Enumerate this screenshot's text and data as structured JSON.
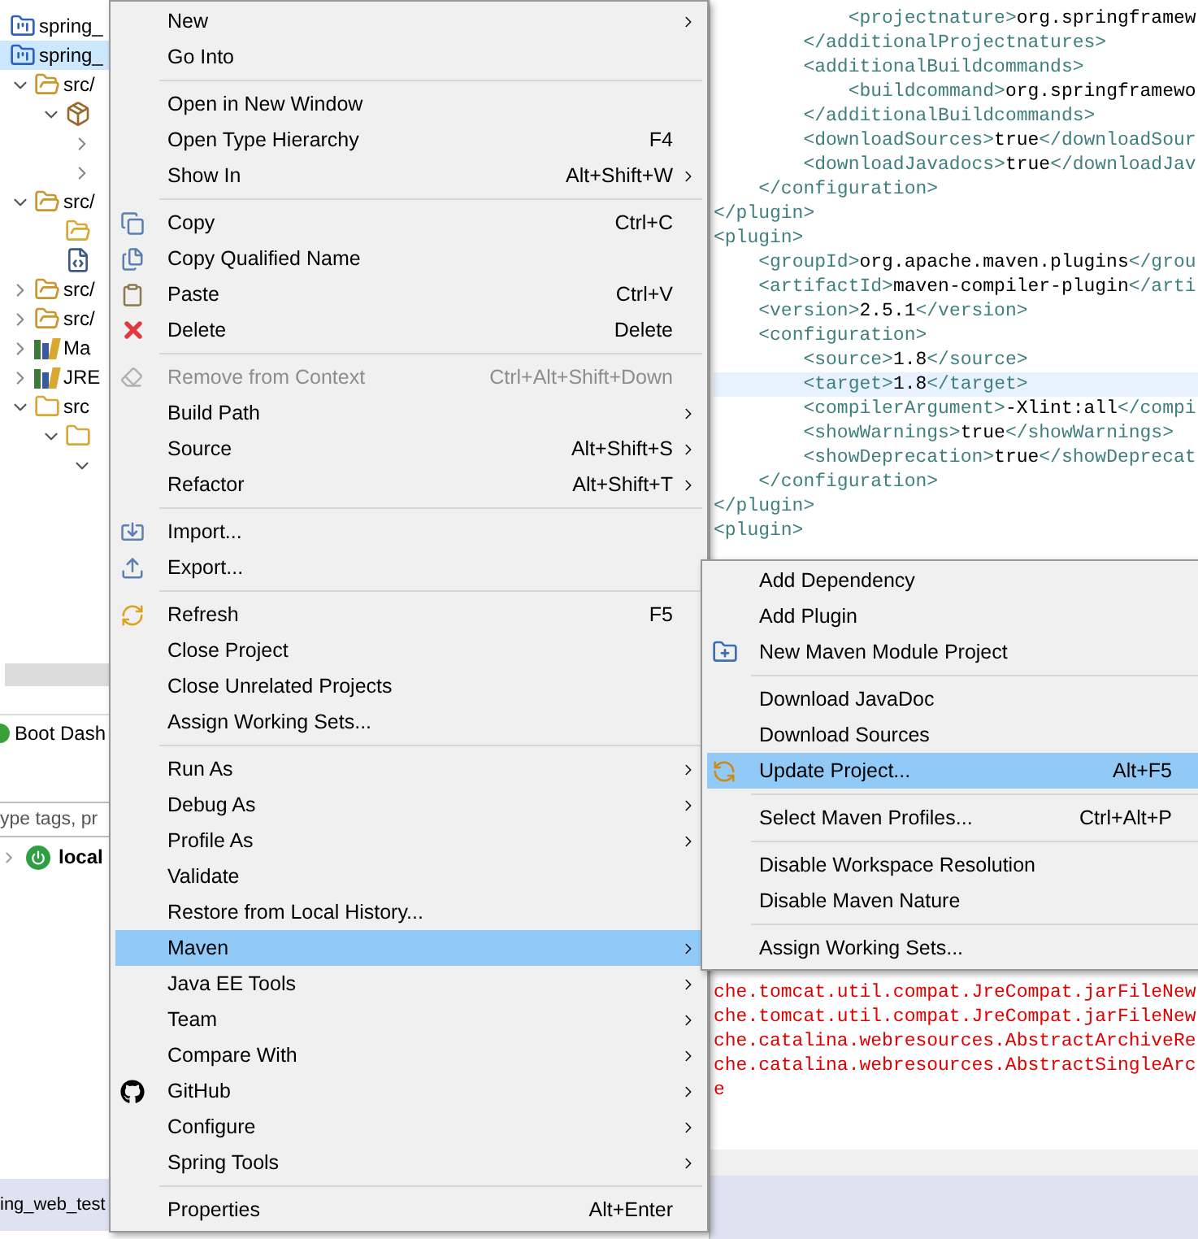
{
  "project_explorer": {
    "items": [
      {
        "label": "spring_",
        "kind": "project",
        "selected": false
      },
      {
        "label": "spring_",
        "kind": "project",
        "selected": true,
        "children": [
          {
            "label": "src/",
            "kind": "source-folder",
            "expanded": true,
            "selected": false,
            "children": [
              {
                "kind": "package",
                "expanded": true,
                "selected": false,
                "children": [
                  {
                    "expanded": false,
                    "selected": false
                  },
                  {
                    "expanded": false,
                    "selected": false
                  }
                ]
              }
            ]
          },
          {
            "label": "src/",
            "kind": "source-folder",
            "expanded": true,
            "selected": false,
            "children": [
              {
                "kind": "folder",
                "selected": false
              },
              {
                "kind": "file",
                "selected": false
              }
            ]
          },
          {
            "label": "src/",
            "kind": "source-folder",
            "expanded": false,
            "selected": false
          },
          {
            "label": "src/",
            "kind": "source-folder",
            "expanded": false,
            "selected": false
          },
          {
            "label": "Ma",
            "kind": "library",
            "expanded": false,
            "selected": false
          },
          {
            "label": "JRE",
            "kind": "library",
            "expanded": false,
            "selected": false
          },
          {
            "label": "src",
            "kind": "spring-folder",
            "expanded": true,
            "selected": false,
            "children": [
              {
                "kind": "spring-folder",
                "expanded": true,
                "selected": false,
                "children": [
                  {
                    "expanded": true,
                    "selected": false
                  }
                ]
              }
            ]
          }
        ]
      }
    ]
  },
  "boot_dashboard": {
    "tab": "Boot Dash",
    "search": {
      "placeholder": "ype tags, pr"
    },
    "targets": [
      {
        "label": "local",
        "expanded": false
      }
    ]
  },
  "editor": {
    "lines": [
      {
        "text": "            <projectnature>org.springframew",
        "current": false
      },
      {
        "text": "        </additionalProjectnatures>",
        "current": false
      },
      {
        "text": "        <additionalBuildcommands>",
        "current": false
      },
      {
        "text": "            <buildcommand>org.springframewo",
        "current": false
      },
      {
        "text": "        </additionalBuildcommands>",
        "current": false
      },
      {
        "text": "        <downloadSources>true</downloadSour",
        "current": false
      },
      {
        "text": "        <downloadJavadocs>true</downloadJav",
        "current": false
      },
      {
        "text": "    </configuration>",
        "current": false
      },
      {
        "text": "</plugin>",
        "current": false
      },
      {
        "text": "<plugin>",
        "current": false
      },
      {
        "text": "    <groupId>org.apache.maven.plugins</grou",
        "current": false
      },
      {
        "text": "    <artifactId>maven-compiler-plugin</arti",
        "current": false
      },
      {
        "text": "    <version>2.5.1</version>",
        "current": false
      },
      {
        "text": "    <configuration>",
        "current": false
      },
      {
        "text": "        <source>1.8</source>",
        "current": false
      },
      {
        "text": "        <target>1.8</target>",
        "current": true
      },
      {
        "text": "        <compilerArgument>-Xlint:all</compi",
        "current": false
      },
      {
        "text": "        <showWarnings>true</showWarnings>",
        "current": false
      },
      {
        "text": "        <showDeprecation>true</showDeprecat",
        "current": false
      },
      {
        "text": "    </configuration>",
        "current": false
      },
      {
        "text": "</plugin>",
        "current": false
      },
      {
        "text": "<plugin>",
        "current": false
      }
    ]
  },
  "console": {
    "lines": [
      "che.tomcat.util.compat.JreCompat.jarFileNew",
      "che.tomcat.util.compat.JreCompat.jarFileNew",
      "che.catalina.webresources.AbstractArchiveRe",
      "che.catalina.webresources.AbstractSingleArc",
      "e"
    ]
  },
  "status_bar": {
    "text": "ing_web_test"
  },
  "context_menu": {
    "groups": [
      {
        "items": [
          {
            "label": "New",
            "submenu": true,
            "selected": false,
            "disabled": false
          },
          {
            "label": "Go Into",
            "submenu": false,
            "selected": false,
            "disabled": false
          }
        ]
      },
      {
        "items": [
          {
            "label": "Open in New Window",
            "submenu": false,
            "selected": false,
            "disabled": false
          },
          {
            "label": "Open Type Hierarchy",
            "shortcut": "F4",
            "submenu": false,
            "selected": false,
            "disabled": false
          },
          {
            "label": "Show In",
            "shortcut": "Alt+Shift+W",
            "submenu": true,
            "selected": false,
            "disabled": false
          }
        ]
      },
      {
        "items": [
          {
            "label": "Copy",
            "shortcut": "Ctrl+C",
            "submenu": false,
            "selected": false,
            "disabled": false
          },
          {
            "label": "Copy Qualified Name",
            "submenu": false,
            "selected": false,
            "disabled": false
          },
          {
            "label": "Paste",
            "shortcut": "Ctrl+V",
            "submenu": false,
            "selected": false,
            "disabled": false
          },
          {
            "label": "Delete",
            "shortcut": "Delete",
            "submenu": false,
            "selected": false,
            "disabled": false
          }
        ]
      },
      {
        "items": [
          {
            "label": "Remove from Context",
            "shortcut": "Ctrl+Alt+Shift+Down",
            "submenu": false,
            "selected": false,
            "disabled": true
          },
          {
            "label": "Build Path",
            "submenu": true,
            "selected": false,
            "disabled": false
          },
          {
            "label": "Source",
            "shortcut": "Alt+Shift+S",
            "submenu": true,
            "selected": false,
            "disabled": false
          },
          {
            "label": "Refactor",
            "shortcut": "Alt+Shift+T",
            "submenu": true,
            "selected": false,
            "disabled": false
          }
        ]
      },
      {
        "items": [
          {
            "label": "Import...",
            "submenu": false,
            "selected": false,
            "disabled": false
          },
          {
            "label": "Export...",
            "submenu": false,
            "selected": false,
            "disabled": false
          }
        ]
      },
      {
        "items": [
          {
            "label": "Refresh",
            "shortcut": "F5",
            "submenu": false,
            "selected": false,
            "disabled": false
          },
          {
            "label": "Close Project",
            "submenu": false,
            "selected": false,
            "disabled": false
          },
          {
            "label": "Close Unrelated Projects",
            "submenu": false,
            "selected": false,
            "disabled": false
          },
          {
            "label": "Assign Working Sets...",
            "submenu": false,
            "selected": false,
            "disabled": false
          }
        ]
      },
      {
        "items": [
          {
            "label": "Run As",
            "submenu": true,
            "selected": false,
            "disabled": false
          },
          {
            "label": "Debug As",
            "submenu": true,
            "selected": false,
            "disabled": false
          },
          {
            "label": "Profile As",
            "submenu": true,
            "selected": false,
            "disabled": false
          },
          {
            "label": "Validate",
            "submenu": false,
            "selected": false,
            "disabled": false
          },
          {
            "label": "Restore from Local History...",
            "submenu": false,
            "selected": false,
            "disabled": false
          },
          {
            "label": "Maven",
            "submenu": true,
            "selected": true,
            "disabled": false
          },
          {
            "label": "Java EE Tools",
            "submenu": true,
            "selected": false,
            "disabled": false
          },
          {
            "label": "Team",
            "submenu": true,
            "selected": false,
            "disabled": false
          },
          {
            "label": "Compare With",
            "submenu": true,
            "selected": false,
            "disabled": false
          },
          {
            "label": "GitHub",
            "submenu": true,
            "selected": false,
            "disabled": false
          },
          {
            "label": "Configure",
            "submenu": true,
            "selected": false,
            "disabled": false
          },
          {
            "label": "Spring Tools",
            "submenu": true,
            "selected": false,
            "disabled": false
          }
        ]
      },
      {
        "items": [
          {
            "label": "Properties",
            "shortcut": "Alt+Enter",
            "submenu": false,
            "selected": false,
            "disabled": false
          }
        ]
      }
    ]
  },
  "maven_submenu": {
    "groups": [
      {
        "items": [
          {
            "label": "Add Dependency",
            "submenu": false,
            "selected": false,
            "disabled": false
          },
          {
            "label": "Add Plugin",
            "submenu": false,
            "selected": false,
            "disabled": false
          },
          {
            "label": "New Maven Module Project",
            "submenu": false,
            "selected": false,
            "disabled": false
          }
        ]
      },
      {
        "items": [
          {
            "label": "Download JavaDoc",
            "submenu": false,
            "selected": false,
            "disabled": false
          },
          {
            "label": "Download Sources",
            "submenu": false,
            "selected": false,
            "disabled": false
          },
          {
            "label": "Update Project...",
            "shortcut": "Alt+F5",
            "submenu": false,
            "selected": true,
            "disabled": false
          }
        ]
      },
      {
        "items": [
          {
            "label": "Select Maven Profiles...",
            "shortcut": "Ctrl+Alt+P",
            "submenu": false,
            "selected": false,
            "disabled": false
          }
        ]
      },
      {
        "items": [
          {
            "label": "Disable Workspace Resolution",
            "submenu": false,
            "selected": false,
            "disabled": false
          },
          {
            "label": "Disable Maven Nature",
            "submenu": false,
            "selected": false,
            "disabled": false
          }
        ]
      },
      {
        "items": [
          {
            "label": "Assign Working Sets...",
            "submenu": false,
            "selected": false,
            "disabled": false
          }
        ]
      }
    ]
  }
}
